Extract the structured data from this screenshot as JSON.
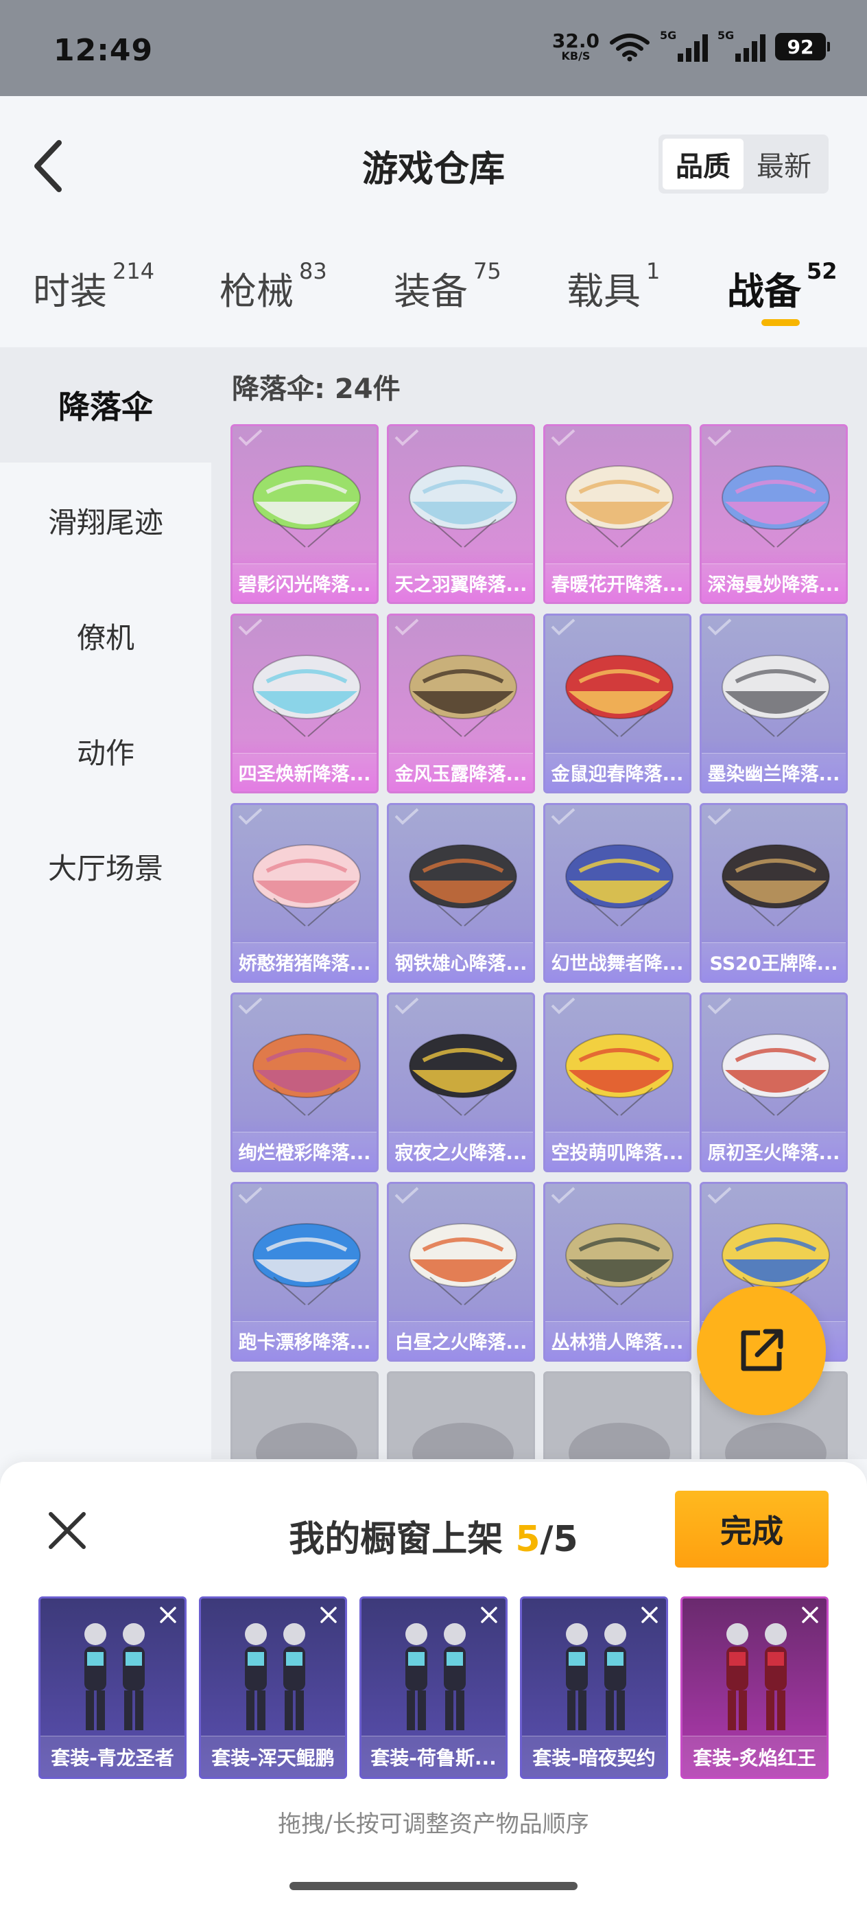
{
  "status_bar": {
    "time": "12:49",
    "net_speed_value": "32.0",
    "net_speed_unit": "KB/S",
    "signal1_tag": "5G",
    "signal2_tag": "5G",
    "battery": "92"
  },
  "header": {
    "title": "游戏仓库",
    "sort_options": [
      "品质",
      "最新"
    ],
    "sort_selected": "品质"
  },
  "tabs": [
    {
      "label": "时装",
      "count": "214"
    },
    {
      "label": "枪械",
      "count": "83"
    },
    {
      "label": "装备",
      "count": "75"
    },
    {
      "label": "载具",
      "count": "1"
    },
    {
      "label": "战备",
      "count": "52",
      "active": true
    }
  ],
  "side_nav": [
    {
      "label": "降落伞",
      "active": true
    },
    {
      "label": "滑翔尾迹"
    },
    {
      "label": "僚机"
    },
    {
      "label": "动作"
    },
    {
      "label": "大厅场景"
    }
  ],
  "content": {
    "heading": "降落伞: 24件",
    "items": [
      {
        "name": "碧影闪光降落...",
        "rarity": "purple",
        "colors": [
          "#9be06a",
          "#f2f2f2"
        ]
      },
      {
        "name": "天之羽翼降落...",
        "rarity": "purple",
        "colors": [
          "#dfeaf2",
          "#9fd0e6"
        ]
      },
      {
        "name": "春暖花开降落...",
        "rarity": "purple",
        "colors": [
          "#f3e9d6",
          "#e9b46a"
        ]
      },
      {
        "name": "深海曼妙降落...",
        "rarity": "purple",
        "colors": [
          "#7c9ee8",
          "#e08ad8"
        ]
      },
      {
        "name": "四圣焕新降落...",
        "rarity": "purple",
        "colors": [
          "#e8e8ee",
          "#7ad0e6"
        ]
      },
      {
        "name": "金风玉露降落...",
        "rarity": "purple",
        "colors": [
          "#c9b07a",
          "#4a3a2a"
        ]
      },
      {
        "name": "金鼠迎春降落...",
        "rarity": "blue",
        "colors": [
          "#d23b3b",
          "#f5c35a"
        ]
      },
      {
        "name": "墨染幽兰降落...",
        "rarity": "blue",
        "colors": [
          "#e8e8ea",
          "#6a6a70"
        ]
      },
      {
        "name": "娇憨猪猪降落...",
        "rarity": "blue",
        "colors": [
          "#f7d2d6",
          "#e88a96"
        ]
      },
      {
        "name": "钢铁雄心降落...",
        "rarity": "blue",
        "colors": [
          "#3a3a3e",
          "#d0703a"
        ]
      },
      {
        "name": "幻世战舞者降...",
        "rarity": "blue",
        "colors": [
          "#4a5ab0",
          "#f0d040"
        ]
      },
      {
        "name": "SS20王牌降...",
        "rarity": "blue",
        "colors": [
          "#3a3436",
          "#c9a060"
        ]
      },
      {
        "name": "绚烂橙彩降落...",
        "rarity": "blue",
        "colors": [
          "#e07a4a",
          "#c05a8a"
        ]
      },
      {
        "name": "寂夜之火降落...",
        "rarity": "blue",
        "colors": [
          "#2e2e34",
          "#e8c040"
        ]
      },
      {
        "name": "空投萌叽降落...",
        "rarity": "blue",
        "colors": [
          "#f2d040",
          "#e05030"
        ]
      },
      {
        "name": "原初圣火降落...",
        "rarity": "blue",
        "colors": [
          "#eeeef2",
          "#d05040"
        ]
      },
      {
        "name": "跑卡漂移降落...",
        "rarity": "blue",
        "colors": [
          "#3a8ae0",
          "#e8e8ee"
        ]
      },
      {
        "name": "白昼之火降落...",
        "rarity": "blue",
        "colors": [
          "#f2f0ea",
          "#e06a3a"
        ]
      },
      {
        "name": "丛林猎人降落...",
        "rarity": "blue",
        "colors": [
          "#c9b880",
          "#4a5040"
        ]
      },
      {
        "name": "",
        "rarity": "blue",
        "colors": [
          "#f0d050",
          "#3a70d0"
        ]
      }
    ]
  },
  "sheet": {
    "title_prefix": "我的橱窗上架 ",
    "title_count": "5",
    "title_total": "/5",
    "done_label": "完成",
    "items": [
      {
        "name": "套装-青龙圣者",
        "theme": "blue"
      },
      {
        "name": "套装-浑天鲲鹏",
        "theme": "blue"
      },
      {
        "name": "套装-荷鲁斯...",
        "theme": "blue"
      },
      {
        "name": "套装-暗夜契约",
        "theme": "blue"
      },
      {
        "name": "套装-炙焰红王",
        "theme": "red"
      }
    ],
    "hint": "拖拽/长按可调整资产物品顺序"
  },
  "colors": {
    "accent": "#f7b500",
    "fab": "#ffb21a",
    "rarity_purple": "#d67ad8",
    "rarity_blue": "#9a8de0"
  }
}
